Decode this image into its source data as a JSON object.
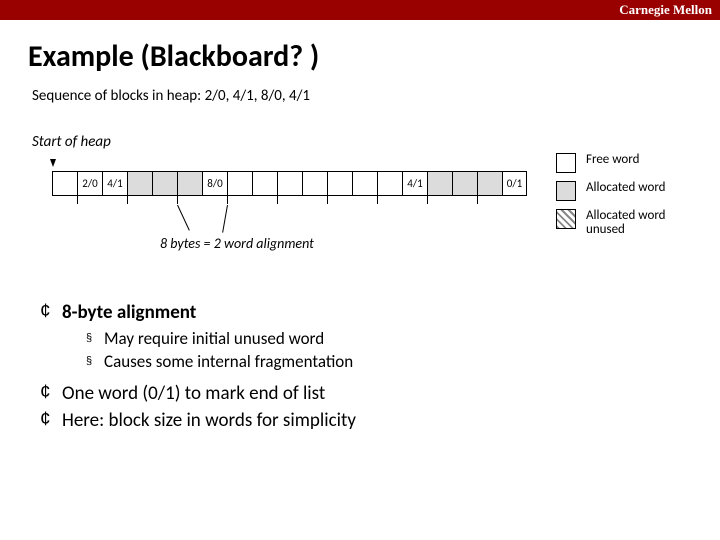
{
  "banner": {
    "org": "Carnegie Mellon"
  },
  "title": "Example (Blackboard? )",
  "subtitle": "Sequence of blocks in heap: 2/0, 4/1, 8/0, 4/1",
  "start_label": "Start of heap",
  "cells": {
    "c1": "2/0",
    "c2": "4/1",
    "c6": "8/0",
    "c14": "4/1",
    "c18": "0/1"
  },
  "legend": {
    "free": "Free word",
    "alloc": "Allocated word",
    "unused": "Allocated word unused"
  },
  "align_label": "8 bytes = 2 word alignment",
  "bullets": {
    "b1": "8-byte alignment",
    "b1a": "May require initial unused word",
    "b1b": "Causes some internal fragmentation",
    "b2": "One word (0/1) to mark end of list",
    "b3": "Here: block size in words for simplicity"
  }
}
